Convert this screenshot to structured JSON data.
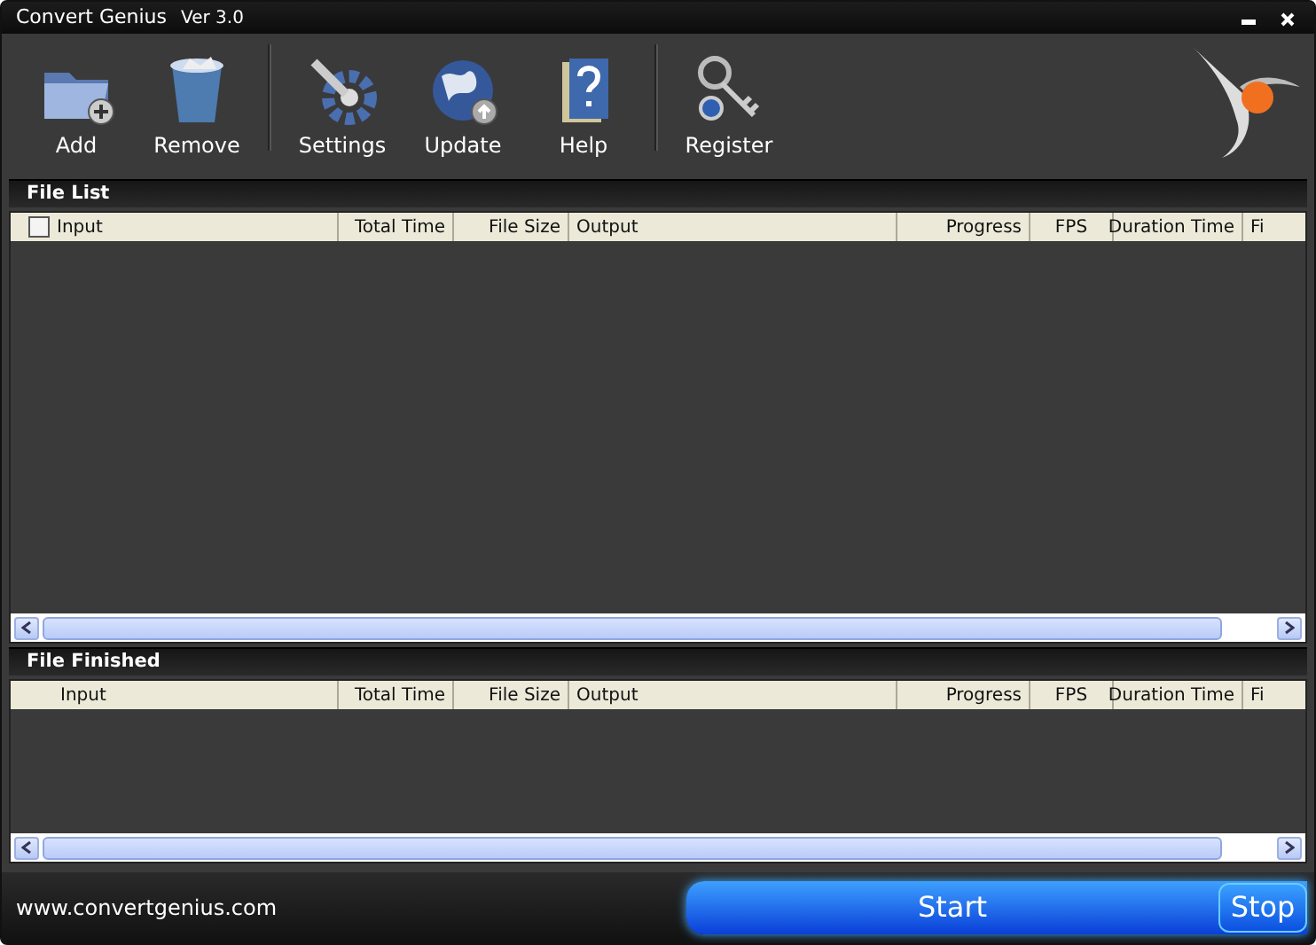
{
  "window": {
    "title": "Convert Genius",
    "version": "Ver 3.0"
  },
  "toolbar_groups": [
    [
      {
        "kind": "add",
        "label": "Add"
      },
      {
        "kind": "remove",
        "label": "Remove"
      }
    ],
    [
      {
        "kind": "settings",
        "label": "Settings"
      },
      {
        "kind": "update",
        "label": "Update"
      },
      {
        "kind": "help",
        "label": "Help"
      }
    ],
    [
      {
        "kind": "register",
        "label": "Register"
      }
    ]
  ],
  "sections": [
    {
      "title": "File List",
      "checkbox": {
        "checked": false
      },
      "columns": [
        "Input",
        "Total Time",
        "File Size",
        "Output",
        "Progress",
        "FPS",
        "Duration Time",
        "Fi"
      ]
    },
    {
      "title": "File Finished",
      "columns": [
        "Input",
        "Total Time",
        "File Size",
        "Output",
        "Progress",
        "FPS",
        "Duration Time",
        "Fi"
      ]
    }
  ],
  "footer": {
    "website": "www.convertgenius.com",
    "start": "Start",
    "stop": "Stop"
  }
}
